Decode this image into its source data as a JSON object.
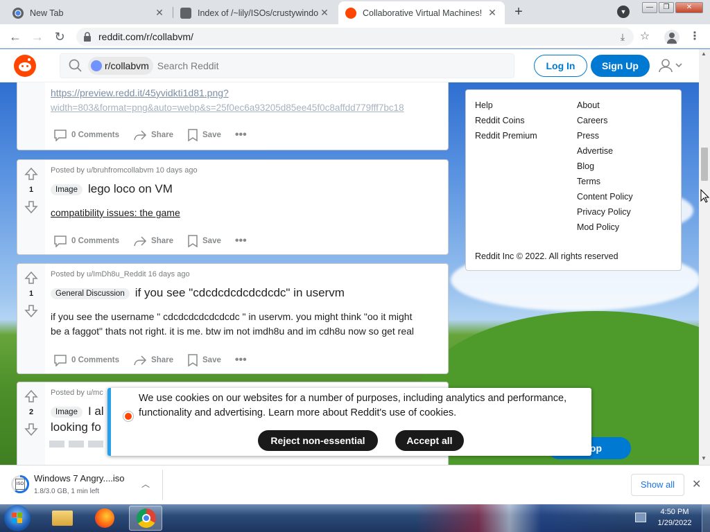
{
  "browser": {
    "tabs": [
      {
        "label": "New Tab",
        "active": false
      },
      {
        "label": "Index of /~lily/ISOs/crustywindo",
        "active": false
      },
      {
        "label": "Collaborative Virtual Machines!",
        "active": true
      }
    ],
    "url": "reddit.com/r/collabvm/"
  },
  "reddit": {
    "subreddit_chip": "r/collabvm",
    "search_placeholder": "Search Reddit",
    "login_label": "Log In",
    "signup_label": "Sign Up"
  },
  "posts": [
    {
      "link_line1": "https://preview.redd.it/45yvidkti1d81.png?",
      "link_line2": "width=803&format=png&auto=webp&s=25f0ec6a93205d85ee45f0c8affdd779fff7bc18",
      "comments": "0 Comments",
      "share": "Share",
      "save": "Save"
    },
    {
      "meta": "Posted by u/bruhfromcollabvm 10 days ago",
      "votes": "1",
      "flair": "Image",
      "title": "lego loco on VM",
      "link": "compatibility issues: the game",
      "comments": "0 Comments",
      "share": "Share",
      "save": "Save"
    },
    {
      "meta": "Posted by u/ImDh8u_Reddit 16 days ago",
      "votes": "1",
      "flair": "General Discussion",
      "title": "if you see \"cdcdcdcdcdcdcdc\" in uservm",
      "body_line1": "if you see the username \" cdcdcdcdcdcdcdc \" in uservm. you might think \"oo it might",
      "body_line2": "be a faggot\" thats not right. it is me. btw im not imdh8u and im cdh8u now so get real",
      "comments": "0 Comments",
      "share": "Share",
      "save": "Save"
    },
    {
      "meta": "Posted by u/mc",
      "votes": "2",
      "flair": "Image",
      "title_line1": "I al",
      "title_line2": "looking fo"
    }
  ],
  "sidebar": {
    "col1": [
      "Help",
      "Reddit Coins",
      "Reddit Premium"
    ],
    "col2": [
      "About",
      "Careers",
      "Press",
      "Advertise",
      "Blog",
      "Terms",
      "Content Policy",
      "Privacy Policy",
      "Mod Policy"
    ],
    "copyright": "Reddit Inc © 2022. All rights reserved"
  },
  "cookie": {
    "text_line1": "We use cookies on our websites for a number of purposes, including analytics and performance,",
    "text_line2": "functionality and advertising. Learn more about Reddit's use of cookies.",
    "reject": "Reject non-essential",
    "accept": "Accept all",
    "partial_button": "op"
  },
  "download": {
    "filename": "Windows 7 Angry....iso",
    "progress_text": "1.8/3.0 GB, 1 min left",
    "progress": 0.6,
    "show_all": "Show all"
  },
  "taskbar": {
    "time": "4:50 PM",
    "date": "1/29/2022"
  },
  "colors": {
    "reddit_orange": "#ff4500",
    "reddit_blue": "#0079d3",
    "cookie_accent": "#24a0ed"
  }
}
